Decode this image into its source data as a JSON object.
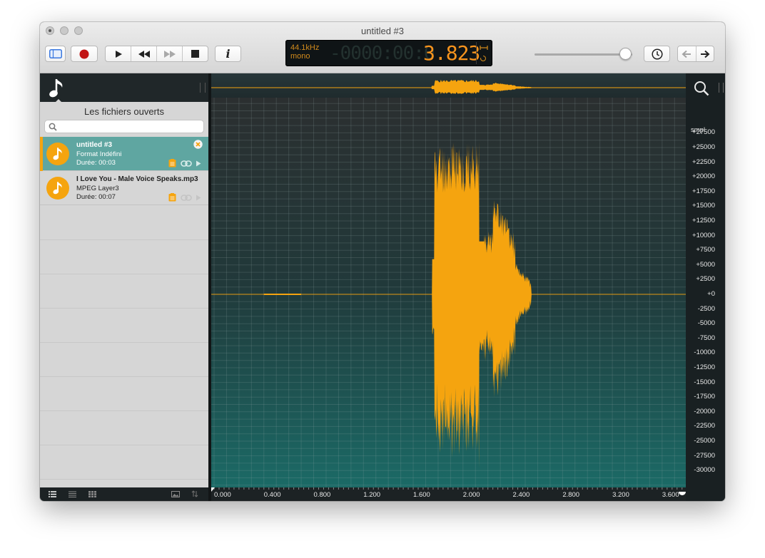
{
  "window": {
    "title": "untitled #3"
  },
  "toolbar": {
    "sidebar_toggle": "sidebar-toggle",
    "record": "record",
    "play": "play",
    "rewind": "rewind",
    "fast_forward": "fast-forward",
    "stop": "stop",
    "info_label": "i",
    "history": "history",
    "back": "back",
    "forward": "forward",
    "zoom_slider_level": 0.93
  },
  "lcd": {
    "rate": "44.1kHz",
    "channels": "mono",
    "ghost_digits": "-0000:00:0",
    "time": "3.823"
  },
  "sidebar": {
    "title": "Les fichiers ouverts",
    "search_placeholder": "",
    "files": [
      {
        "name": "untitled #3",
        "format": "Format Indéfini",
        "duration": "Durée: 00:03",
        "selected": true
      },
      {
        "name": "I Love You - Male Voice Speaks.mp3",
        "format": "MPEG Layer3",
        "duration": "Durée: 00:07",
        "selected": false
      }
    ]
  },
  "ruler": {
    "unit": "smpl",
    "ticks": [
      "+27500",
      "+25000",
      "+22500",
      "+20000",
      "+17500",
      "+15000",
      "+12500",
      "+10000",
      "+7500",
      "+5000",
      "+2500",
      "+0",
      "-2500",
      "-5000",
      "-7500",
      "-10000",
      "-12500",
      "-15000",
      "-17500",
      "-20000",
      "-22500",
      "-25000",
      "-27500",
      "-30000"
    ]
  },
  "time_axis": {
    "ticks": [
      "0.000",
      "0.400",
      "0.800",
      "1.200",
      "1.600",
      "2.000",
      "2.400",
      "2.800",
      "3.200",
      "3.600"
    ]
  },
  "colors": {
    "waveform": "#f5a40f",
    "canvas_bottom": "#1b6a66",
    "canvas_top": "#2b2f30",
    "lcd_time": "#f7941e"
  }
}
